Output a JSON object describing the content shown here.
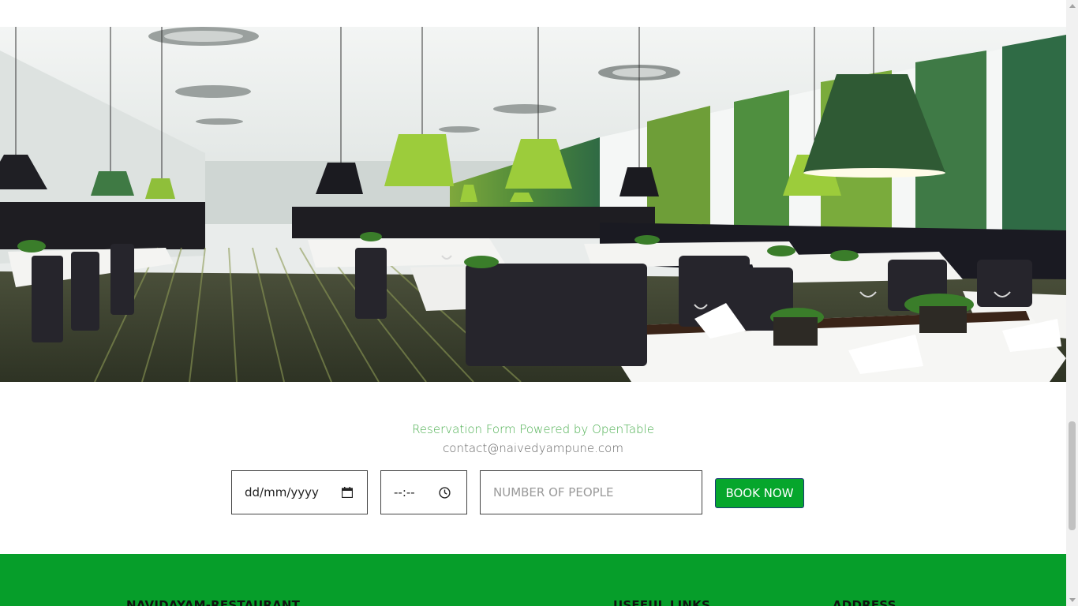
{
  "reservation": {
    "powered_by": "Reservation Form Powered by OpenTable",
    "contact_email": "contact@naivedyampune.com",
    "date_display": "dd/mm/yyyy",
    "time_display": "--:--",
    "people_placeholder": "NUMBER OF PEOPLE",
    "book_label": "BOOK NOW"
  },
  "footer": {
    "headings": [
      "NAVIDAYAM-RESTAURANT",
      "USEFUL LINKS",
      "ADDRESS"
    ]
  },
  "icons": [
    "calendar-icon",
    "clock-icon"
  ],
  "colors": {
    "accent_green": "#06a62c",
    "footer_green": "#069e2a",
    "powered_text": "#4caf50"
  }
}
